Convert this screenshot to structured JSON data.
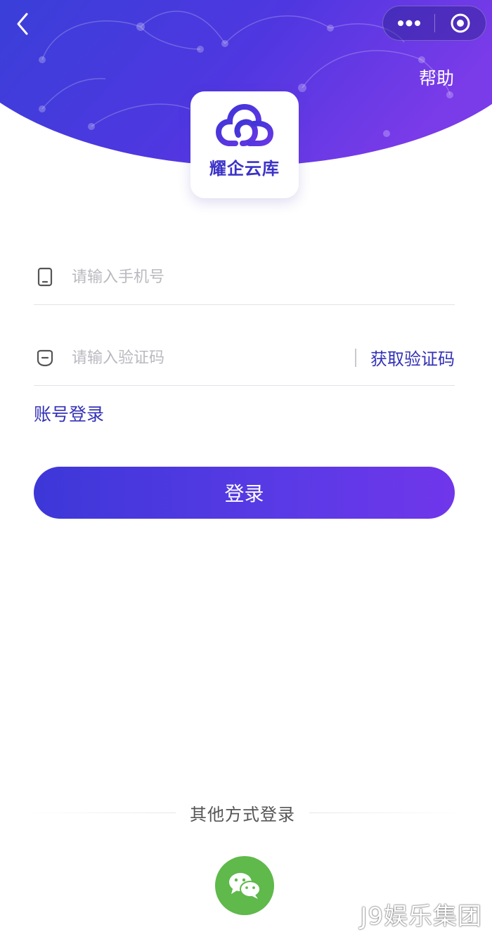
{
  "header": {
    "help_label": "帮助",
    "back_icon": "chevron-left-icon",
    "more_icon": "more-dots-icon",
    "close_icon": "target-circle-icon"
  },
  "logo": {
    "icon": "cloud-logo-icon",
    "text": "耀企云库"
  },
  "form": {
    "phone": {
      "icon": "phone-icon",
      "placeholder": "请输入手机号",
      "value": ""
    },
    "code": {
      "icon": "shield-code-icon",
      "placeholder": "请输入验证码",
      "value": "",
      "get_code_label": "获取验证码"
    },
    "account_login_label": "账号登录",
    "login_button_label": "登录"
  },
  "other_login": {
    "label": "其他方式登录",
    "wechat_icon": "wechat-icon"
  },
  "watermark": "J9娱乐集团",
  "colors": {
    "primary": "#3d37d8",
    "primary_end": "#7036ea",
    "link": "#3331b6",
    "wechat": "#5fb94b"
  }
}
